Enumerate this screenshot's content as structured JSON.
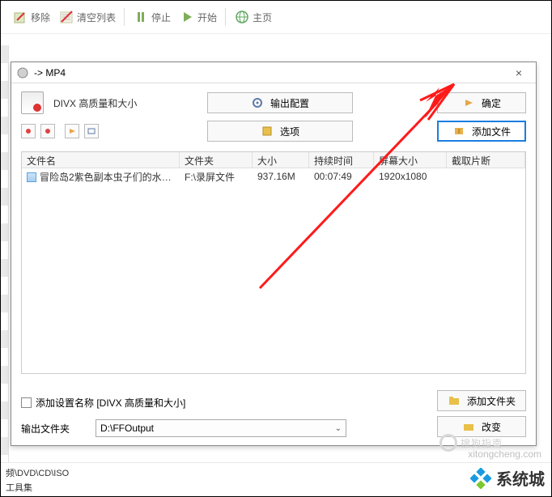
{
  "toolbar": {
    "remove": "移除",
    "clearList": "清空列表",
    "stop": "停止",
    "start": "开始",
    "home": "主页"
  },
  "dialog": {
    "title": "-> MP4",
    "qualityLabel": "DIVX 高质量和大小",
    "outputConfig": "输出配置",
    "ok": "确定",
    "options": "选项",
    "addFile": "添加文件",
    "addFolder": "添加文件夹",
    "change": "改变",
    "addProfileCheckbox": "添加设置名称 [DIVX 高质量和大小]",
    "outputFolderLabel": "输出文件夹",
    "outputFolderValue": "D:\\FFOutput"
  },
  "grid": {
    "headers": {
      "filename": "文件名",
      "folder": "文件夹",
      "size": "大小",
      "duration": "持续时间",
      "resolution": "屏幕大小",
      "clip": "截取片断"
    },
    "rows": [
      {
        "filename": "冒险岛2紫色副本虫子们的水上乐园水...",
        "folder": "F:\\录屏文件",
        "size": "937.16M",
        "duration": "00:07:49",
        "resolution": "1920x1080",
        "clip": ""
      }
    ]
  },
  "footer": {
    "line1": "频\\DVD\\CD\\ISO",
    "line2": "工具集"
  },
  "watermark": {
    "sogo": "搜狗指南",
    "url": "xitongcheng.com",
    "logo": "系统城"
  }
}
